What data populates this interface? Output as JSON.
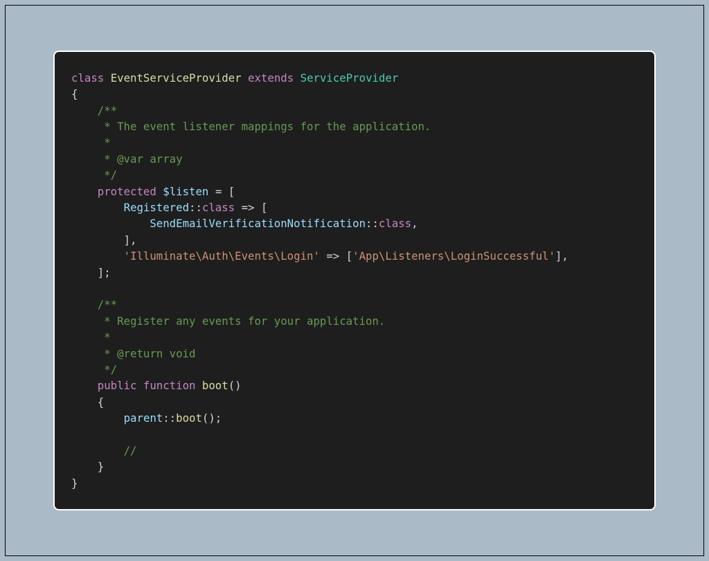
{
  "code": {
    "l1": {
      "kw1": "class",
      "cls": "EventServiceProvider",
      "kw2": "extends",
      "type": "ServiceProvider"
    },
    "l2": {
      "brace": "{"
    },
    "l3": {
      "c": "/**"
    },
    "l4": {
      "c": " * The event listener mappings for the application."
    },
    "l5": {
      "c": " *"
    },
    "l6": {
      "c": " * @var array"
    },
    "l7": {
      "c": " */"
    },
    "l8": {
      "kw": "protected",
      "var": "$listen",
      "eq": "=",
      "br": "["
    },
    "l9": {
      "id": "Registered",
      "cc": "::",
      "kw": "class",
      "arr": "=>",
      "br": "["
    },
    "l10": {
      "id": "SendEmailVerificationNotification",
      "cc": "::",
      "kw": "class",
      "comma": ","
    },
    "l11": {
      "br": "]",
      "comma": ","
    },
    "l12": {
      "s1": "'Illuminate\\Auth\\Events\\Login'",
      "arr": "=>",
      "br1": "[",
      "s2": "'App\\Listeners\\LoginSuccessful'",
      "br2": "]",
      "comma": ","
    },
    "l13": {
      "br": "]",
      "semi": ";"
    },
    "l14": {
      "c": "/**"
    },
    "l15": {
      "c": " * Register any events for your application."
    },
    "l16": {
      "c": " *"
    },
    "l17": {
      "c": " * @return void"
    },
    "l18": {
      "c": " */"
    },
    "l19": {
      "kw": "public",
      "kw2": "function",
      "fn": "boot",
      "paren": "()"
    },
    "l20": {
      "brace": "{"
    },
    "l21": {
      "id": "parent",
      "cc": "::",
      "fn": "boot",
      "rest": "();"
    },
    "l22": {
      "c": "//"
    },
    "l23": {
      "brace": "}"
    },
    "l24": {
      "brace": "}"
    }
  }
}
